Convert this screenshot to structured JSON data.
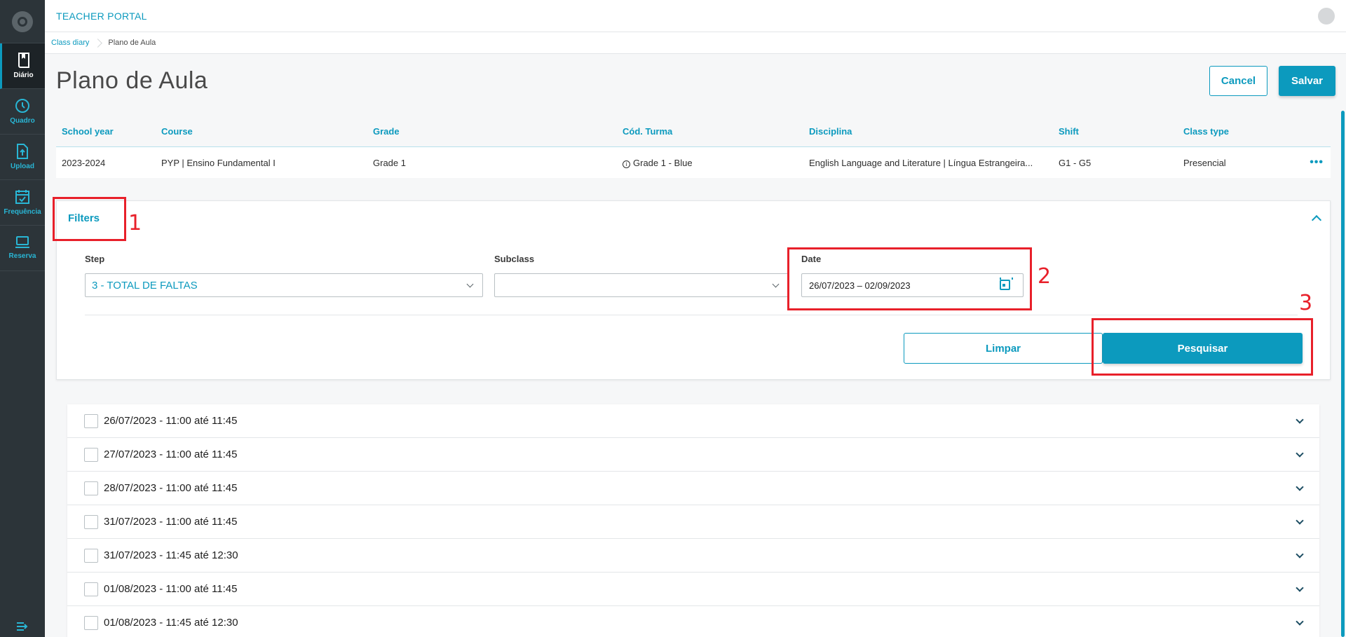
{
  "app": {
    "title": "TEACHER PORTAL"
  },
  "sidebar": {
    "items": [
      {
        "label": "Diário",
        "icon": "book-icon",
        "active": true
      },
      {
        "label": "Quadro",
        "icon": "clock-icon"
      },
      {
        "label": "Upload",
        "icon": "upload-icon"
      },
      {
        "label": "Frequência",
        "icon": "calendar-check-icon"
      },
      {
        "label": "Reserva",
        "icon": "laptop-icon"
      }
    ]
  },
  "breadcrumb": {
    "items": [
      "Class diary",
      "Plano de Aula"
    ]
  },
  "page": {
    "title": "Plano de Aula",
    "cancel_label": "Cancel",
    "save_label": "Salvar"
  },
  "info_table": {
    "headers": [
      "School year",
      "Course",
      "Grade",
      "Cód. Turma",
      "Disciplina",
      "Shift",
      "Class type"
    ],
    "row": [
      "2023-2024",
      "PYP | Ensino Fundamental I",
      "Grade 1",
      "Grade 1 - Blue",
      "English Language and Literature | Língua Estrangeira...",
      "G1 - G5",
      "Presencial"
    ],
    "more_label": "•••"
  },
  "filters": {
    "title": "Filters",
    "step_label": "Step",
    "step_value": "3 - TOTAL DE FALTAS",
    "subclass_label": "Subclass",
    "subclass_value": "",
    "date_label": "Date",
    "date_value": "26/07/2023 – 02/09/2023",
    "clear_label": "Limpar",
    "search_label": "Pesquisar"
  },
  "annotations": [
    "1",
    "2",
    "3"
  ],
  "lessons": [
    "26/07/2023 - 11:00 até 11:45",
    "27/07/2023 - 11:00 até 11:45",
    "28/07/2023 - 11:00 até 11:45",
    "31/07/2023 - 11:00 até 11:45",
    "31/07/2023 - 11:45 até 12:30",
    "01/08/2023 - 11:00 até 11:45",
    "01/08/2023 - 11:45 até 12:30"
  ],
  "colors": {
    "accent": "#0c9abe",
    "sidebar": "#2c3439",
    "annotation": "#e8202a"
  }
}
